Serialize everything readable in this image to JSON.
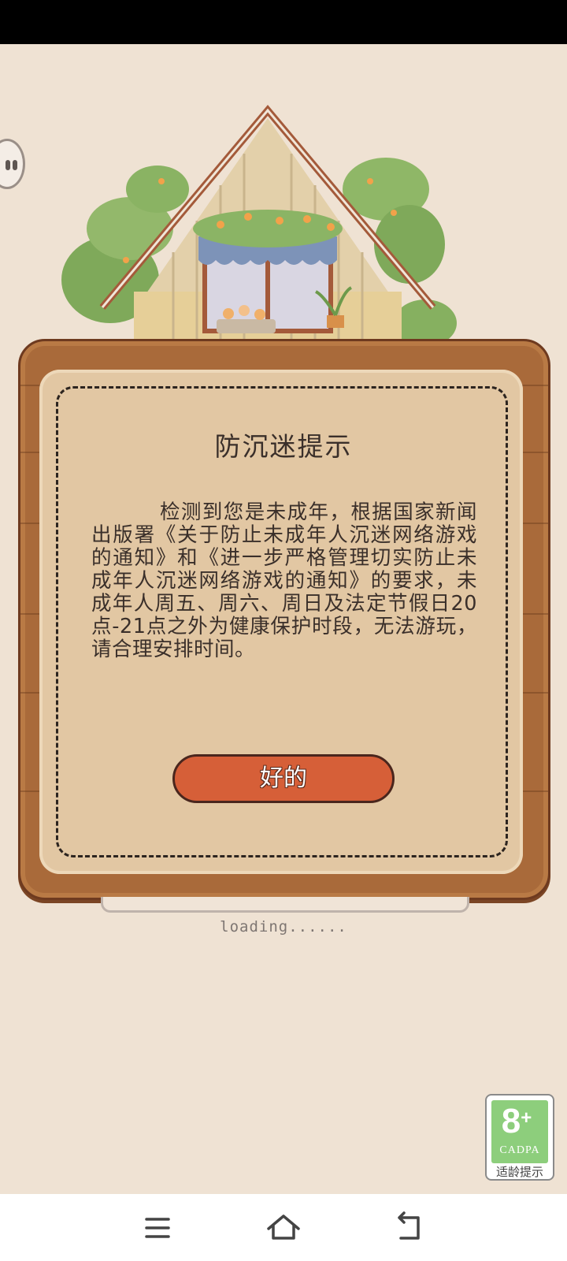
{
  "dialog": {
    "title": "防沉迷提示",
    "body": "检测到您是未成年，根据国家新闻出版署《关于防止未成年人沉迷网络游戏的通知》和《进一步严格管理切实防止未成年人沉迷网络游戏的通知》的要求，未成年人周五、周六、周日及法定节假日20点-21点之外为健康保护时段，无法游玩，请合理安排时间。",
    "ok_label": "好的"
  },
  "loading": {
    "text": "loading......"
  },
  "age_rating": {
    "number": "8",
    "plus": "+",
    "org": "CADPA",
    "caption": "适龄提示"
  },
  "nav": {
    "menu_icon": "menu-icon",
    "home_icon": "home-icon",
    "back_icon": "back-icon"
  },
  "colors": {
    "background": "#efe2d3",
    "board": "#a96a3a",
    "panel": "#e2c7a3",
    "button": "#d65f38",
    "badge_green": "#8dce7c"
  }
}
